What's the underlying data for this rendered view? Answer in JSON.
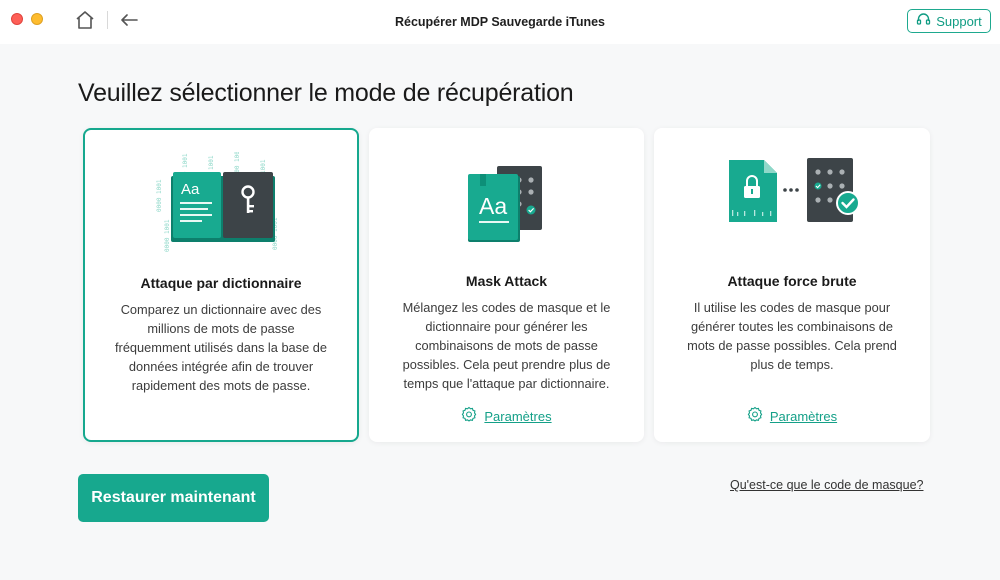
{
  "window": {
    "title": "Récupérer MDP Sauvegarde iTunes",
    "support_label": "Support"
  },
  "main": {
    "heading": "Veuillez sélectionner le mode de récupération",
    "cards": [
      {
        "title": "Attaque par dictionnaire",
        "description": "Comparez un dictionnaire avec des millions de mots de passe fréquemment utilisés dans la base de données intégrée afin de trouver rapidement des mots de passe.",
        "selected": true
      },
      {
        "title": "Mask Attack",
        "description": "Mélangez les codes de masque et le dictionnaire pour générer les combinaisons de mots de passe possibles. Cela peut prendre plus de temps que l'attaque par dictionnaire.",
        "params_label": "Paramètres",
        "selected": false
      },
      {
        "title": "Attaque force brute",
        "description": "Il utilise les codes de masque pour générer toutes les combinaisons de mots de passe possibles. Cela prend plus de temps.",
        "params_label": "Paramètres",
        "selected": false
      }
    ],
    "illustration_text": {
      "book_letters": "Aa",
      "binary": "0000 1001"
    },
    "restore_label": "Restaurer maintenant",
    "mask_link": "Qu'est-ce que le code de masque?"
  },
  "colors": {
    "accent": "#17a88e",
    "accent_dark": "#0d8f78",
    "dark_panel": "#3d4448"
  },
  "icons": [
    "home-icon",
    "back-arrow-icon",
    "support-chat-icon",
    "gear-icon",
    "key-icon",
    "lock-icon",
    "check-icon"
  ]
}
